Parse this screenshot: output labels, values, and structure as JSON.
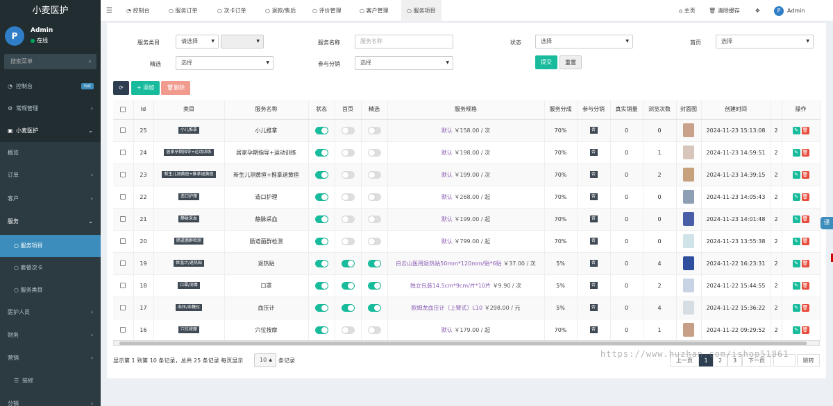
{
  "app": {
    "title": "小麦医护",
    "user": "Admin",
    "status": "在线",
    "search_placeholder": "搜索菜单"
  },
  "menu": {
    "dashboard": "控制台",
    "hot": "hot",
    "general": "常规管理",
    "xiaomai": "小麦医护",
    "overview": "概览",
    "orders": "订单",
    "customers": "客户",
    "service": "服务",
    "service_items": "服务项目",
    "packages": "套餐次卡",
    "service_cat": "服务类目",
    "staff": "医护人员",
    "finance": "财务",
    "marketing": "营销",
    "decor": "装修",
    "distribution": "分销"
  },
  "tabs": [
    "控制台",
    "服务订单",
    "次卡订单",
    "退款/售后",
    "评价管理",
    "客户管理",
    "服务项目"
  ],
  "topright": {
    "home": "主页",
    "clear": "清除缓存",
    "admin": "Admin"
  },
  "filters": {
    "cat_label": "服务类目",
    "cat_value": "请选择",
    "name_label": "服务名称",
    "name_ph": "服务名称",
    "status_label": "状态",
    "status_value": "选择",
    "home_label": "首页",
    "home_value": "选择",
    "featured_label": "精选",
    "featured_value": "选择",
    "dist_label": "参与分销",
    "dist_value": "选择",
    "submit": "提交",
    "reset": "重置"
  },
  "toolbar": {
    "refresh": "⟳",
    "add": "+ 添加",
    "del": "删除"
  },
  "columns": [
    "Id",
    "类目",
    "服务名称",
    "状态",
    "首页",
    "精选",
    "服务规格",
    "服务分成",
    "参与分销",
    "真实销量",
    "浏览次数",
    "封面图",
    "创建时间",
    "操作"
  ],
  "rows": [
    {
      "id": "25",
      "cat": "小儿推拿",
      "name": "小儿推拿",
      "status": true,
      "home": false,
      "featured": false,
      "spec": "默认",
      "price": "￥158.00 / 次",
      "share": "70%",
      "dist": "否",
      "sales": "0",
      "views": "0",
      "cover": "#c9a08a",
      "time": "2024-11-23 15:13:08",
      "extra": "2"
    },
    {
      "id": "24",
      "cat": "居家孕期指导+运动训练",
      "name": "居家孕期指导+运动训练",
      "status": true,
      "home": false,
      "featured": false,
      "spec": "默认",
      "price": "￥198.00 / 次",
      "share": "70%",
      "dist": "否",
      "sales": "0",
      "views": "1",
      "cover": "#d8c6bc",
      "time": "2024-11-23 14:59:51",
      "extra": "2"
    },
    {
      "id": "23",
      "cat": "新生儿测黄疸+推拿退黄疸",
      "name": "新生儿测黄疸+推拿退黄疸",
      "status": true,
      "home": false,
      "featured": false,
      "spec": "默认",
      "price": "￥199.00 / 次",
      "share": "70%",
      "dist": "否",
      "sales": "0",
      "views": "2",
      "cover": "#c7a07c",
      "time": "2024-11-23 14:39:15",
      "extra": "2"
    },
    {
      "id": "22",
      "cat": "造口护理",
      "name": "造口护理",
      "status": true,
      "home": false,
      "featured": false,
      "spec": "默认",
      "price": "￥268.00 / 起",
      "share": "70%",
      "dist": "否",
      "sales": "0",
      "views": "0",
      "cover": "#8d9fb5",
      "time": "2024-11-23 14:05:43",
      "extra": "2"
    },
    {
      "id": "21",
      "cat": "静脉采血",
      "name": "静脉采血",
      "status": true,
      "home": false,
      "featured": false,
      "spec": "默认",
      "price": "￥199.00 / 起",
      "share": "70%",
      "dist": "否",
      "sales": "0",
      "views": "0",
      "cover": "#4a5ea8",
      "time": "2024-11-23 14:01:48",
      "extra": "2"
    },
    {
      "id": "20",
      "cat": "肠道菌群检测",
      "name": "肠道菌群检测",
      "status": true,
      "home": false,
      "featured": false,
      "spec": "默认",
      "price": "￥799.00 / 起",
      "share": "70%",
      "dist": "否",
      "sales": "0",
      "views": "0",
      "cover": "#cfe3e8",
      "time": "2024-11-23 13:55:38",
      "extra": "2"
    },
    {
      "id": "19",
      "cat": "体温计/退热贴",
      "name": "退热贴",
      "status": true,
      "home": true,
      "featured": true,
      "spec": "白云山医用退热贴50mm*120mm/贴*6贴",
      "price": "￥37.00 / 次",
      "share": "5%",
      "dist": "否",
      "sales": "0",
      "views": "4",
      "cover": "#2d4f9e",
      "time": "2024-11-22 16:23:31",
      "extra": "2"
    },
    {
      "id": "18",
      "cat": "口罩/消毒",
      "name": "口罩",
      "status": true,
      "home": true,
      "featured": true,
      "spec": "独立包装14.5cm*9cm/片*10片",
      "price": "￥9.90 / 次",
      "share": "5%",
      "dist": "否",
      "sales": "0",
      "views": "2",
      "cover": "#c8d4e6",
      "time": "2024-11-22 15:44:55",
      "extra": "2"
    },
    {
      "id": "17",
      "cat": "血压/血糖仪",
      "name": "血压计",
      "status": true,
      "home": true,
      "featured": true,
      "spec": "欧姆龙血压计（上臂式）L10",
      "price": "￥298.00 / 元",
      "share": "5%",
      "dist": "否",
      "sales": "0",
      "views": "4",
      "cover": "#d6dde3",
      "time": "2024-11-22 15:36:22",
      "extra": "2"
    },
    {
      "id": "16",
      "cat": "穴位按摩",
      "name": "穴位按摩",
      "status": true,
      "home": false,
      "featured": false,
      "spec": "默认",
      "price": "￥179.00 / 起",
      "share": "70%",
      "dist": "否",
      "sales": "0",
      "views": "1",
      "cover": "#c79e86",
      "time": "2024-11-22 09:29:52",
      "extra": "2"
    }
  ],
  "footer": {
    "summary": "显示第 1 到第 10 条记录，总共 25 条记录 每页显示",
    "page_size": "10",
    "suffix": "条记录",
    "prev": "上一页",
    "pages": [
      "1",
      "2",
      "3"
    ],
    "next": "下一页",
    "jump": "跳转"
  },
  "watermark": "https://www.huzhan.com/ishop51861",
  "float_btn": "译",
  "colors": {
    "sidebar": "#222d32",
    "accent": "#3c8dbc",
    "switch_on": "#18bc9c",
    "add": "#18bc9c",
    "delete": "#e74c3c",
    "edit": "#18bc9c",
    "spec": "#8a5cb5"
  }
}
